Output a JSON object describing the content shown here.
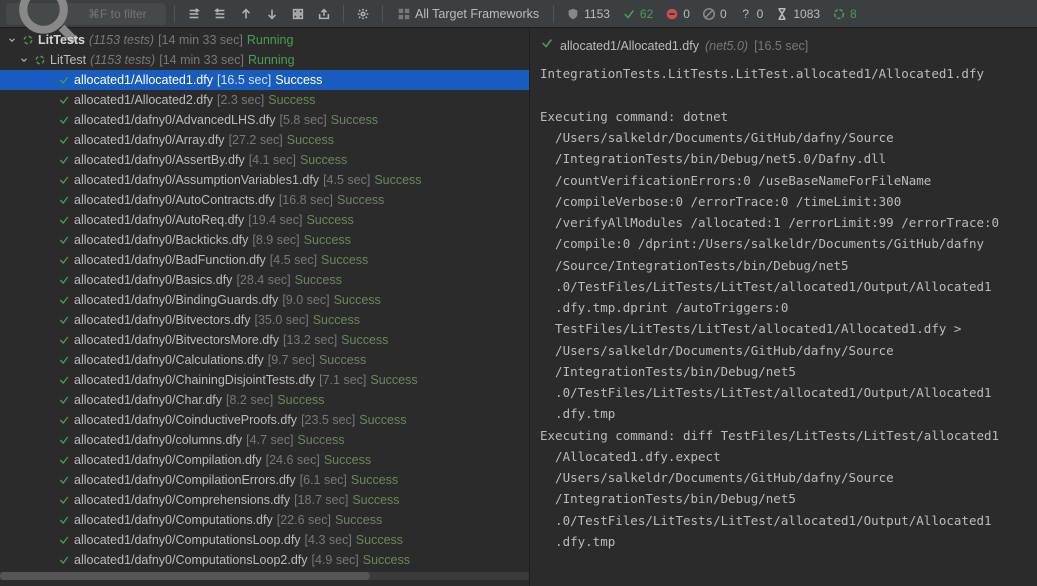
{
  "toolbar": {
    "filter_placeholder": "⌘F to filter",
    "target_label": "All Target Frameworks"
  },
  "stats": {
    "total": "1153",
    "passed": "62",
    "failed": "0",
    "ignored": "0",
    "unknown": "0",
    "time": "1083",
    "running": "8"
  },
  "tree": {
    "root": {
      "name": "LitTests",
      "count": "(1153 tests)",
      "duration": "[14 min 33 sec]",
      "status": "Running"
    },
    "suite": {
      "name": "LitTest",
      "count": "(1153 tests)",
      "duration": "[14 min 33 sec]",
      "status": "Running"
    },
    "tests": [
      {
        "name": "allocated1/Allocated1.dfy",
        "duration": "[16.5 sec]",
        "status": "Success",
        "selected": true
      },
      {
        "name": "allocated1/Allocated2.dfy",
        "duration": "[2.3 sec]",
        "status": "Success"
      },
      {
        "name": "allocated1/dafny0/AdvancedLHS.dfy",
        "duration": "[5.8 sec]",
        "status": "Success"
      },
      {
        "name": "allocated1/dafny0/Array.dfy",
        "duration": "[27.2 sec]",
        "status": "Success"
      },
      {
        "name": "allocated1/dafny0/AssertBy.dfy",
        "duration": "[4.1 sec]",
        "status": "Success"
      },
      {
        "name": "allocated1/dafny0/AssumptionVariables1.dfy",
        "duration": "[4.5 sec]",
        "status": "Success"
      },
      {
        "name": "allocated1/dafny0/AutoContracts.dfy",
        "duration": "[16.8 sec]",
        "status": "Success"
      },
      {
        "name": "allocated1/dafny0/AutoReq.dfy",
        "duration": "[19.4 sec]",
        "status": "Success"
      },
      {
        "name": "allocated1/dafny0/Backticks.dfy",
        "duration": "[8.9 sec]",
        "status": "Success"
      },
      {
        "name": "allocated1/dafny0/BadFunction.dfy",
        "duration": "[4.5 sec]",
        "status": "Success"
      },
      {
        "name": "allocated1/dafny0/Basics.dfy",
        "duration": "[28.4 sec]",
        "status": "Success"
      },
      {
        "name": "allocated1/dafny0/BindingGuards.dfy",
        "duration": "[9.0 sec]",
        "status": "Success"
      },
      {
        "name": "allocated1/dafny0/Bitvectors.dfy",
        "duration": "[35.0 sec]",
        "status": "Success"
      },
      {
        "name": "allocated1/dafny0/BitvectorsMore.dfy",
        "duration": "[13.2 sec]",
        "status": "Success"
      },
      {
        "name": "allocated1/dafny0/Calculations.dfy",
        "duration": "[9.7 sec]",
        "status": "Success"
      },
      {
        "name": "allocated1/dafny0/ChainingDisjointTests.dfy",
        "duration": "[7.1 sec]",
        "status": "Success"
      },
      {
        "name": "allocated1/dafny0/Char.dfy",
        "duration": "[8.2 sec]",
        "status": "Success"
      },
      {
        "name": "allocated1/dafny0/CoinductiveProofs.dfy",
        "duration": "[23.5 sec]",
        "status": "Success"
      },
      {
        "name": "allocated1/dafny0/columns.dfy",
        "duration": "[4.7 sec]",
        "status": "Success"
      },
      {
        "name": "allocated1/dafny0/Compilation.dfy",
        "duration": "[24.6 sec]",
        "status": "Success"
      },
      {
        "name": "allocated1/dafny0/CompilationErrors.dfy",
        "duration": "[6.1 sec]",
        "status": "Success"
      },
      {
        "name": "allocated1/dafny0/Comprehensions.dfy",
        "duration": "[18.7 sec]",
        "status": "Success"
      },
      {
        "name": "allocated1/dafny0/Computations.dfy",
        "duration": "[22.6 sec]",
        "status": "Success"
      },
      {
        "name": "allocated1/dafny0/ComputationsLoop.dfy",
        "duration": "[4.3 sec]",
        "status": "Success"
      },
      {
        "name": "allocated1/dafny0/ComputationsLoop2.dfy",
        "duration": "[4.9 sec]",
        "status": "Success"
      }
    ]
  },
  "detail": {
    "file": "allocated1/Allocated1.dfy",
    "net": "(net5.0)",
    "duration": "[16.5 sec]",
    "lines": [
      {
        "t": "IntegrationTests.LitTests.LitTest.allocated1/Allocated1.dfy",
        "i": false
      },
      {
        "t": "",
        "i": false
      },
      {
        "t": "Executing command: dotnet",
        "i": false
      },
      {
        "t": "/Users/salkeldr/Documents/GitHub/dafny/Source",
        "i": true
      },
      {
        "t": "/IntegrationTests/bin/Debug/net5.0/Dafny.dll",
        "i": true
      },
      {
        "t": "/countVerificationErrors:0 /useBaseNameForFileName",
        "i": true
      },
      {
        "t": "/compileVerbose:0 /errorTrace:0 /timeLimit:300",
        "i": true
      },
      {
        "t": "/verifyAllModules /allocated:1 /errorLimit:99 /errorTrace:0",
        "i": true
      },
      {
        "t": "/compile:0 /dprint:/Users/salkeldr/Documents/GitHub/dafny",
        "i": true
      },
      {
        "t": "/Source/IntegrationTests/bin/Debug/net5",
        "i": true
      },
      {
        "t": ".0/TestFiles/LitTests/LitTest/allocated1/Output/Allocated1",
        "i": true
      },
      {
        "t": ".dfy.tmp.dprint /autoTriggers:0",
        "i": true
      },
      {
        "t": "TestFiles/LitTests/LitTest/allocated1/Allocated1.dfy >",
        "i": true
      },
      {
        "t": "/Users/salkeldr/Documents/GitHub/dafny/Source",
        "i": true
      },
      {
        "t": "/IntegrationTests/bin/Debug/net5",
        "i": true
      },
      {
        "t": ".0/TestFiles/LitTests/LitTest/allocated1/Output/Allocated1",
        "i": true
      },
      {
        "t": ".dfy.tmp",
        "i": true
      },
      {
        "t": "Executing command: diff TestFiles/LitTests/LitTest/allocated1",
        "i": false
      },
      {
        "t": "/Allocated1.dfy.expect",
        "i": true
      },
      {
        "t": "/Users/salkeldr/Documents/GitHub/dafny/Source",
        "i": true
      },
      {
        "t": "/IntegrationTests/bin/Debug/net5",
        "i": true
      },
      {
        "t": ".0/TestFiles/LitTests/LitTest/allocated1/Output/Allocated1",
        "i": true
      },
      {
        "t": ".dfy.tmp",
        "i": true
      }
    ]
  }
}
